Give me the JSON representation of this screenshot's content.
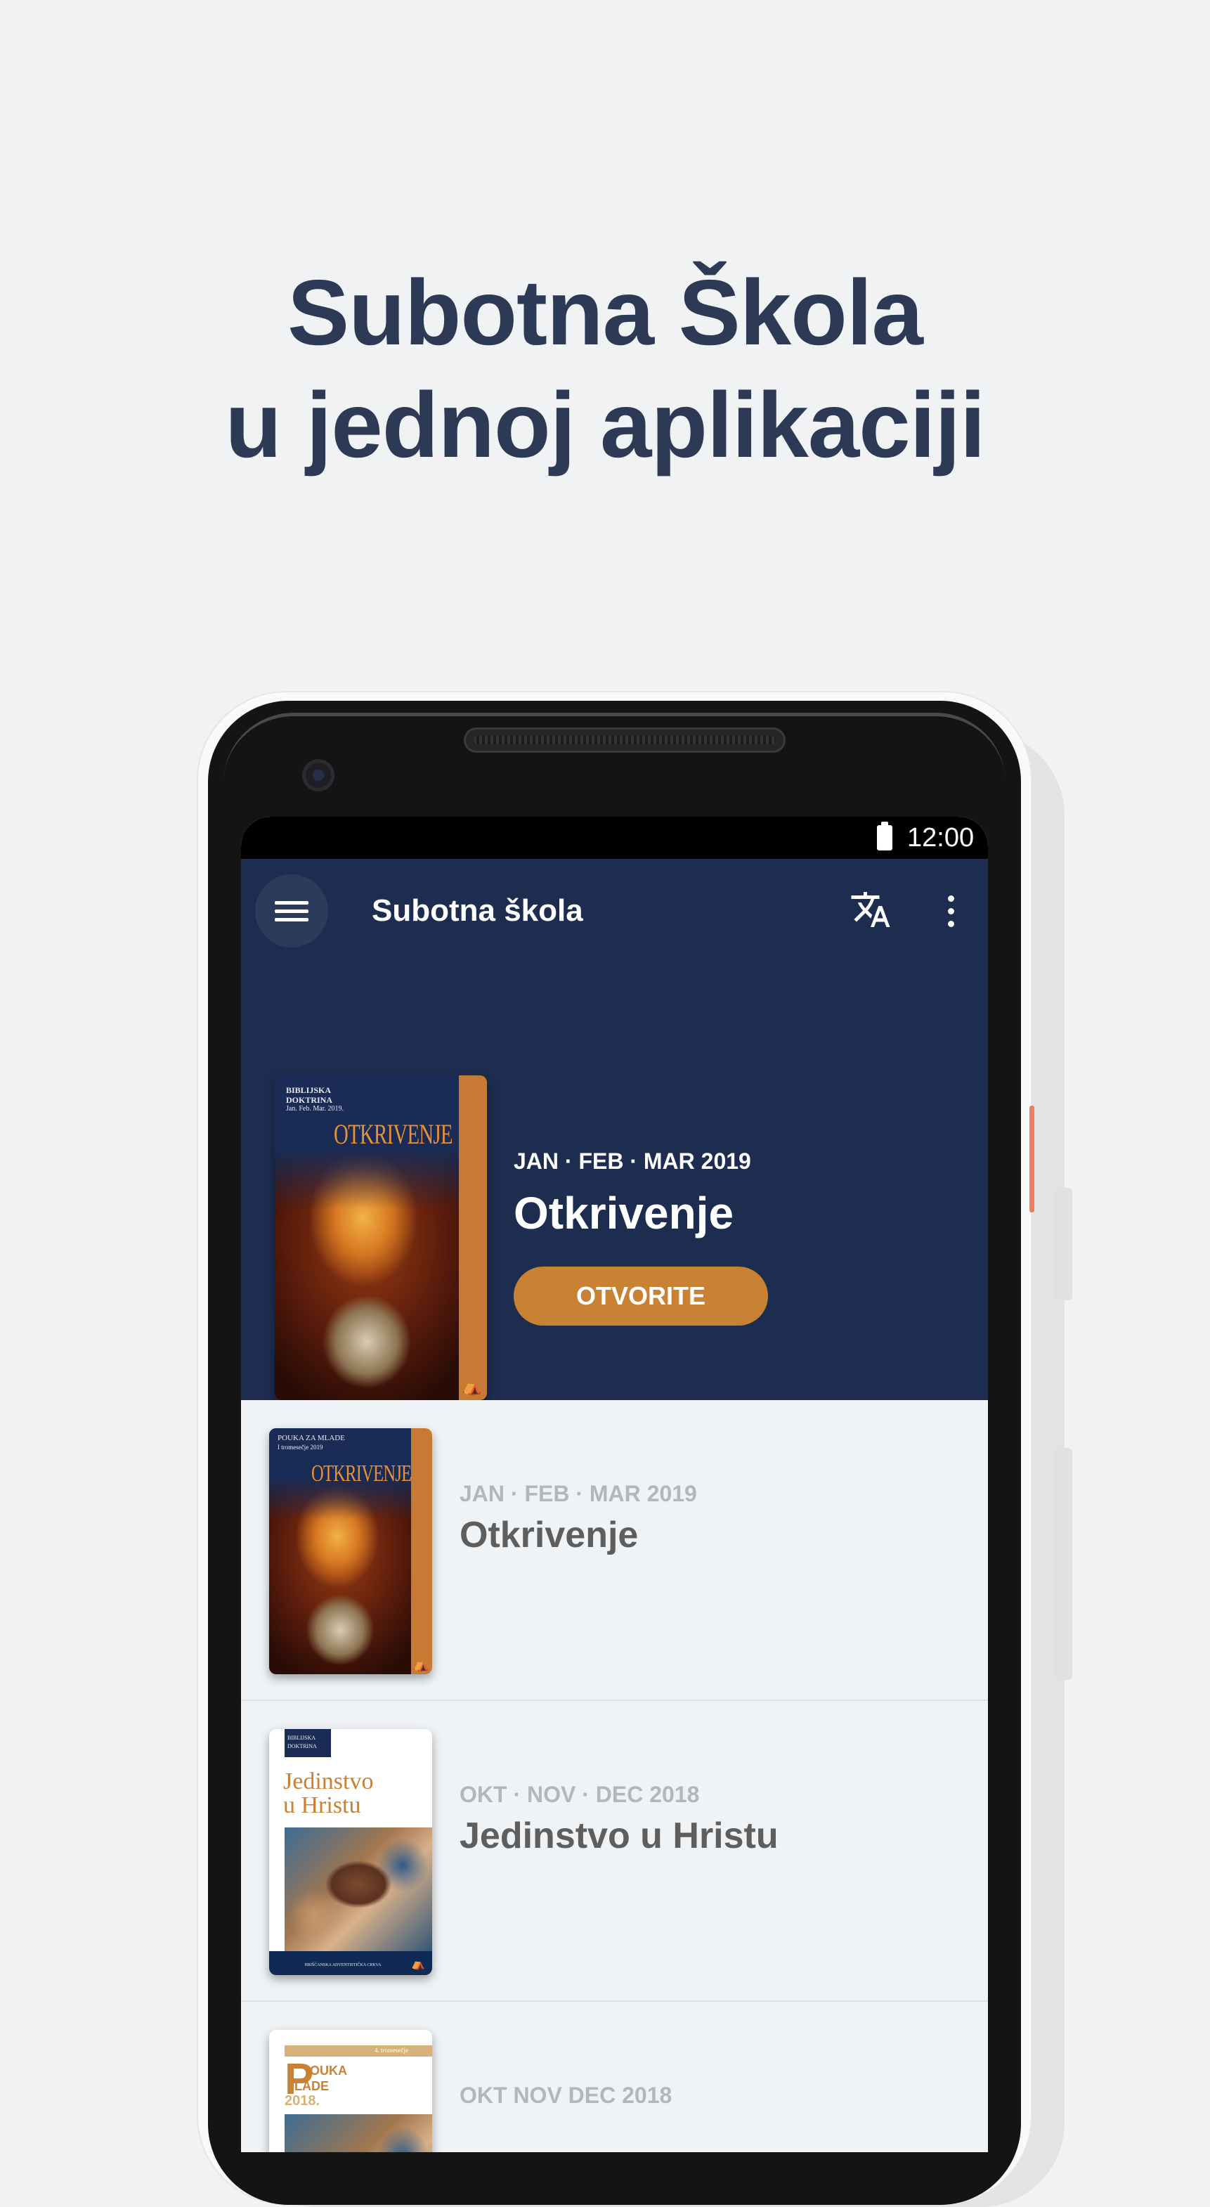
{
  "headline": {
    "line1": "Subotna Škola",
    "line2": "u jednoj aplikaciji"
  },
  "status_bar": {
    "time": "12:00"
  },
  "app_bar": {
    "title": "Subotna škola",
    "icons": [
      "menu-icon",
      "translate-icon",
      "more-vert-icon"
    ]
  },
  "featured": {
    "cover": {
      "top_text_1": "BIBLIJSKA",
      "top_text_2": "DOKTRINA",
      "top_text_3": "Jan. Feb. Mar. 2019.",
      "title": "OTKRIVENJE"
    },
    "quarter": "JAN · FEB · MAR 2019",
    "title": "Otkrivenje",
    "button_label": "OTVORITE"
  },
  "quarterlies": [
    {
      "quarter": "JAN · FEB · MAR 2019",
      "title": "Otkrivenje",
      "cover": {
        "top_text_1": "POUKA ZA MLADE",
        "top_text_2": "I tromesečje 2019",
        "title": "OTKRIVENJE"
      }
    },
    {
      "quarter": "OKT · NOV · DEC 2018",
      "title": "Jedinstvo u Hristu",
      "cover": {
        "top_text_1": "BIBLIJSKA",
        "top_text_2": "DOKTRINA",
        "title_line1": "Jedinstvo",
        "title_line2": "u Hristu",
        "bottom_text": "HRIŠĆANSKA ADVENTISTIČKA CRKVA"
      }
    },
    {
      "quarter": "OKT NOV DEC 2018",
      "title": "",
      "cover": {
        "top_text": "4. tromesečje",
        "title_line1": "OUKA",
        "title_line2": "LADE",
        "year": "2018."
      }
    }
  ],
  "colors": {
    "page_bg": "#f0f2f4",
    "headline": "#2c3a55",
    "app_bar": "#1c2d4f",
    "accent_button": "#c98134",
    "list_bg": "#f0f3f6",
    "list_quarter": "#b3b7bc",
    "list_title": "#5e5e5e"
  }
}
